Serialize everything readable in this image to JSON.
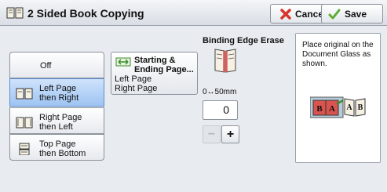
{
  "title": "2 Sided Book Copying",
  "buttons": {
    "cancel": "Cancel",
    "save": "Save"
  },
  "binding_options": [
    {
      "label": "Off",
      "selected": false
    },
    {
      "label": "Left Page then Right",
      "line1": "Left Page",
      "line2": "then Right",
      "selected": true
    },
    {
      "label": "Right Page then Left",
      "line1": "Right Page",
      "line2": "then Left",
      "selected": false
    },
    {
      "label": "Top Page then Bottom",
      "line1": "Top Page",
      "line2": "then Bottom",
      "selected": false
    }
  ],
  "start_ending": {
    "title_line1": "Starting &",
    "title_line2": "Ending Page...",
    "start_value": "Left Page",
    "end_value": "Right Page"
  },
  "binding_edge_erase": {
    "title": "Binding Edge Erase",
    "range": "0↔50mm",
    "value": "0",
    "minus": "−",
    "plus": "+"
  },
  "info": {
    "text": "Place original on the Document Glass as shown."
  },
  "colors": {
    "selected_fill": "#9ec4f2",
    "cancel_icon": "#d9342b",
    "save_icon": "#5cab36"
  }
}
